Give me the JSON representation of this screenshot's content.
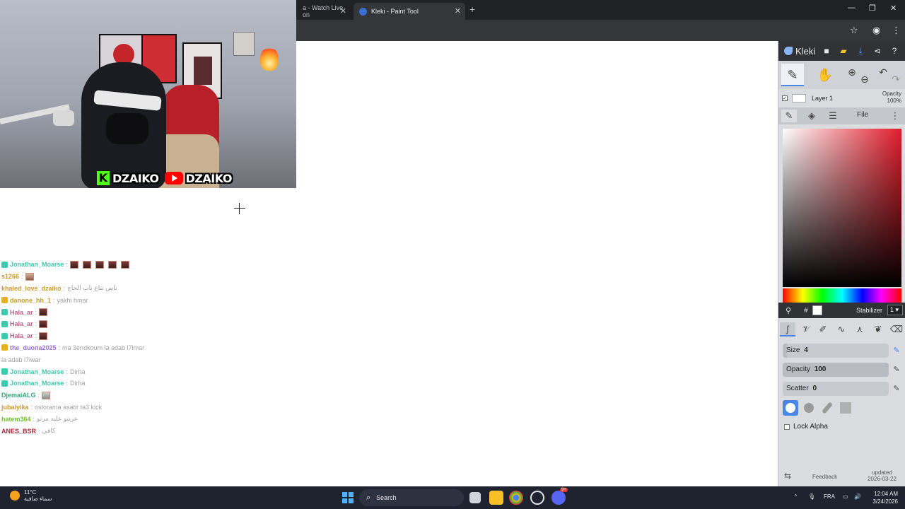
{
  "browser": {
    "tabs": [
      {
        "label": "a - Watch Live on"
      },
      {
        "label": "Kleki - Paint Tool"
      }
    ],
    "new_tab": "+",
    "close_glyph": "✕",
    "window_controls": {
      "minimize": "—",
      "restore": "❐",
      "close": "✕"
    }
  },
  "webcam": {
    "kick_letter": "K",
    "kick_name": "DZAIKO",
    "youtube_name": "DZAIKO"
  },
  "chat": [
    {
      "user": "Jonathan_Moarse",
      "user_color": "#3ec9b0",
      "badge_color": "#3ec9b0",
      "text": "",
      "emotes": 5,
      "emote_style": "emote"
    },
    {
      "user": "s1266",
      "user_color": "#c99a2a",
      "badge_color": "",
      "text": "",
      "emotes": 1,
      "emote_style": "emote2"
    },
    {
      "user": "khaled_love_dzaiko",
      "user_color": "#c99a2a",
      "badge_color": "",
      "text": "ناس نتاع باب الحاج",
      "emotes": 0
    },
    {
      "user": "danone_hh_1",
      "user_color": "#c99a2a",
      "badge_color": "#e6b020",
      "text": "yakhi hmar",
      "emotes": 0
    },
    {
      "user": "Hala_ar",
      "user_color": "#c45a86",
      "badge_color": "#3ec9b0",
      "text": "",
      "emotes": 1,
      "emote_style": "emote"
    },
    {
      "user": "Hala_ar",
      "user_color": "#c45a86",
      "badge_color": "#3ec9b0",
      "text": "",
      "emotes": 1,
      "emote_style": "emote"
    },
    {
      "user": "Hala_ar",
      "user_color": "#c45a86",
      "badge_color": "#3ec9b0",
      "text": "",
      "emotes": 1,
      "emote_style": "emote"
    },
    {
      "user": "the_duona2025",
      "user_color": "#9a6fd6",
      "badge_color": "#e6b020",
      "text": "ma 3endkoum la adab l7imar",
      "emotes": 0
    },
    {
      "user": "",
      "user_color": "#9a9a9a",
      "badge_color": "",
      "text": "la adab l7iwar",
      "emotes": 0
    },
    {
      "user": "Jonathan_Moarse",
      "user_color": "#3ec9b0",
      "badge_color": "#3ec9b0",
      "text": "Dirha",
      "emotes": 0
    },
    {
      "user": "Jonathan_Moarse",
      "user_color": "#3ec9b0",
      "badge_color": "#3ec9b0",
      "text": "Dirha",
      "emotes": 0
    },
    {
      "user": "DjemaiALG",
      "user_color": "#2fa87a",
      "badge_color": "",
      "text": "",
      "emotes": 1,
      "emote_style": "emote3"
    },
    {
      "user": "jubaiyika",
      "user_color": "#c99a2a",
      "badge_color": "",
      "text": "ostorama asatir ta3 kick",
      "emotes": 0
    },
    {
      "user": "hatem364",
      "user_color": "#6fbf2a",
      "badge_color": "",
      "text": "عزيتو عليه مرتو",
      "emotes": 0
    },
    {
      "user": "ANES_BSR",
      "user_color": "#b0243a",
      "badge_color": "",
      "text": "كافي",
      "emotes": 0
    }
  ],
  "kleki": {
    "logo": "Kleki",
    "top_icons": [
      "new-image-icon",
      "open-folder-icon",
      "download-icon",
      "share-icon",
      "help-icon"
    ],
    "tools": [
      "brush-tool-icon",
      "hand-tool-icon",
      "zoom-in-icon",
      "zoom-out-icon",
      "undo-icon",
      "redo-icon"
    ],
    "layer": {
      "name": "Layer 1",
      "opacity_label": "Opacity",
      "opacity_value": "100%"
    },
    "tabs": {
      "file": "File"
    },
    "color": {
      "hex_label": "#",
      "stabilizer_label": "Stabilizer",
      "stabilizer_value": "1 ▾"
    },
    "brush_sliders": [
      {
        "label": "Size",
        "value": "4",
        "fraction": 0.04
      },
      {
        "label": "Opacity",
        "value": "100",
        "fraction": 1.0
      },
      {
        "label": "Scatter",
        "value": "0",
        "fraction": 0.0
      }
    ],
    "lock_alpha": "Lock Alpha",
    "feedback": "Feedback",
    "updated_label": "updated",
    "updated_date": "2026-03-22"
  },
  "taskbar": {
    "temperature": "11°C",
    "weather_text": "سماء صافية",
    "search_label": "Search",
    "language": "FRA",
    "time": "12:04 AM",
    "date": "3/24/2026",
    "discord_badge": "9+"
  },
  "colors": {
    "browser_bg": "#202124",
    "kick_green": "#53fc18",
    "youtube_red": "#ff0000",
    "kleki_accent": "#4a86e8",
    "picker_hue": "#e11d2b"
  }
}
